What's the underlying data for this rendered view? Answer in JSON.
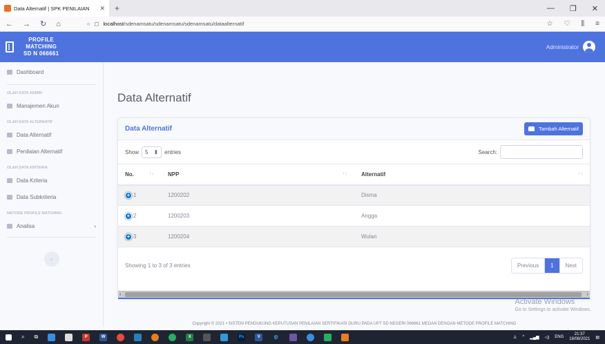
{
  "browser": {
    "tab_title": "Data Alternatif | SPK PENILAIAN",
    "new_tab": "+",
    "url_host": "localhost",
    "url_path": "/sdenamsatu/sdenamsatu/sdenamsatu/dataalternatif"
  },
  "topbar": {
    "brand_lines": [
      "PROFILE",
      "MATCHING",
      "SD N 066661"
    ],
    "user_name": "Administrator",
    "color": "#4e73df"
  },
  "sidebar": {
    "dashboard": "Dashboard",
    "head_admin": "OLAH DATA ADMIN",
    "manajemen_akun": "Manajemen Akun",
    "head_alternatif": "OLAH DATA ALTERNATIF",
    "data_alternatif": "Data Alternatif",
    "penilaian_alternatif": "Penilaian Alternatif",
    "head_kriteria": "OLAH DATA KRITERIA",
    "data_kriteria": "Data Kriteria",
    "data_subkriteria": "Data Subkriteria",
    "head_metode": "METODE PROFILE MATCHING",
    "analisa": "Analisa",
    "toggle": "‹"
  },
  "main": {
    "page_title": "Data Alternatif",
    "card_title": "Data Alternatif",
    "add_button": "Tambah Alternatif",
    "show_label": "Show",
    "entries_value": "5",
    "entries_label": "entries",
    "search_label": "Search:",
    "columns": [
      "No.",
      "NPP",
      "Alternatif"
    ],
    "rows": [
      {
        "no": "1",
        "npp": "1200202",
        "alternatif": "Disma"
      },
      {
        "no": "2",
        "npp": "1200203",
        "alternatif": "Angga"
      },
      {
        "no": "3",
        "npp": "1200204",
        "alternatif": "Wulan"
      }
    ],
    "info": "Showing 1 to 3 of 3 entries",
    "pager": {
      "previous": "Previous",
      "page": "1",
      "next": "Next"
    }
  },
  "watermark": {
    "line1": "Activate Windows",
    "line2": "Go to Settings to activate Windows."
  },
  "copyright": "Copyright © 2021 • SISTEM PENDUKUNG KEPUTUSAN PENILAIAN SERTIFIKASI GURU PADA UPT SD NEGERI 066661 MEDAN DENGAN METODE PROFILE MATCHING",
  "taskbar": {
    "lang": "ENG",
    "time": "21:37",
    "date": "18/08/2021"
  }
}
